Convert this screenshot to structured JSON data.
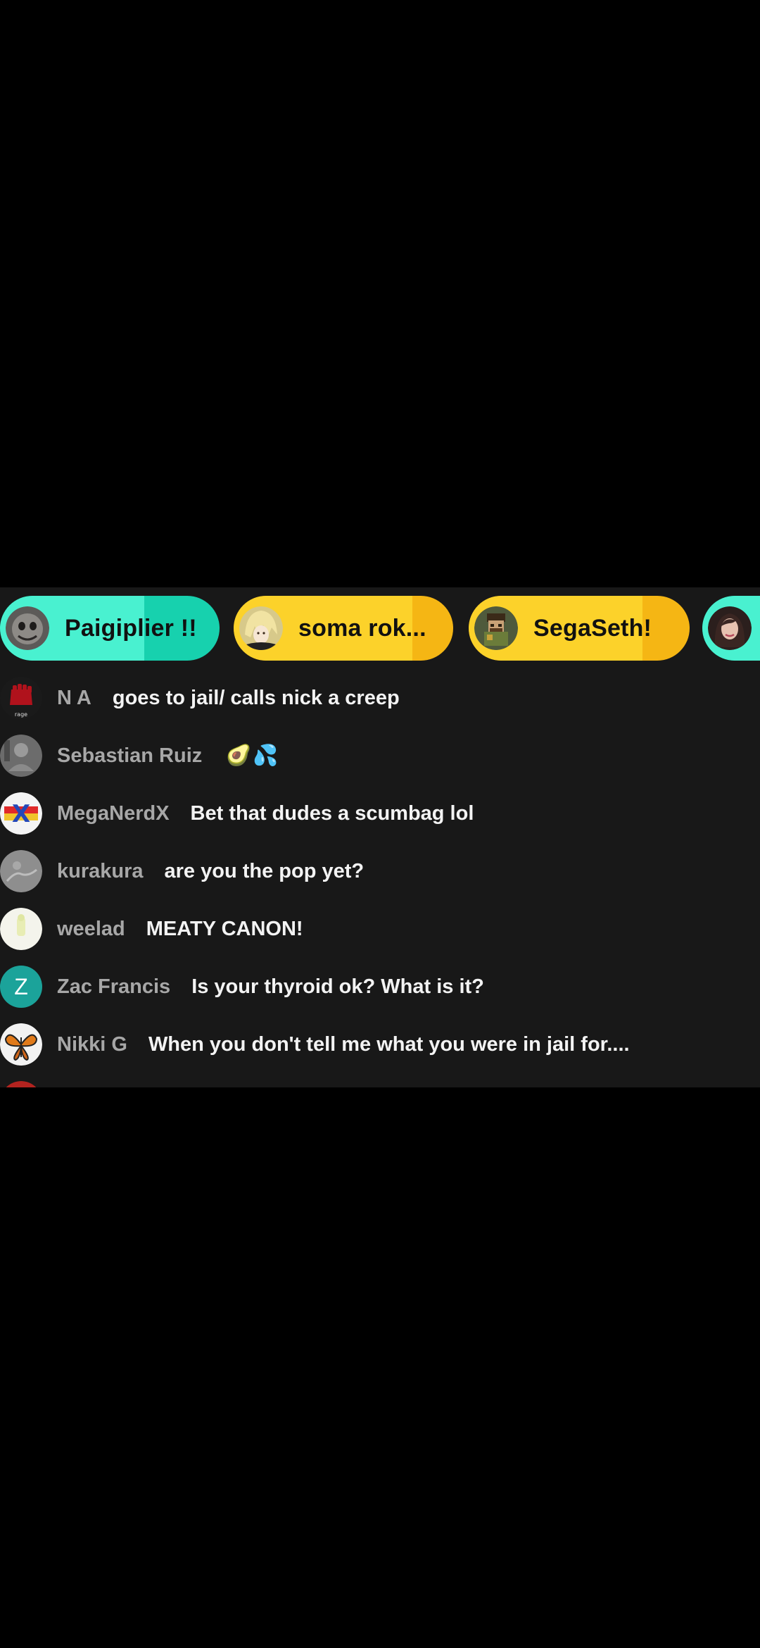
{
  "colors": {
    "background": "#000000",
    "panel": "#181818",
    "pill_teal": "#17d1ae",
    "pill_teal_fill": "#49f1d0",
    "pill_yellow": "#f5b614",
    "pill_yellow_fill": "#fcd22a",
    "username": "#a7a7a7",
    "message": "#f3f3f3",
    "avatar_z": "#1ba39a"
  },
  "top_gifters": [
    {
      "label": "Paigiplier !!",
      "avatar_icon": "creepy-face-avatar"
    },
    {
      "label": "soma rok...",
      "avatar_icon": "blonde-anime-avatar"
    },
    {
      "label": "SegaSeth!",
      "avatar_icon": "pixel-character-avatar"
    },
    {
      "label": "",
      "avatar_icon": "woman-portrait-avatar"
    }
  ],
  "messages": [
    {
      "username": "N A",
      "text": "goes to jail/ calls nick a creep",
      "avatar_icon": "red-fist-avatar",
      "avatar_caption": "rage"
    },
    {
      "username": "Sebastian Ruiz",
      "text": "🥑💦",
      "avatar_icon": "grey-photo-avatar"
    },
    {
      "username": "MegaNerdX",
      "text": "Bet that dudes a scumbag lol",
      "avatar_icon": "x-logo-avatar",
      "avatar_letter": "X"
    },
    {
      "username": "kurakura",
      "text": "are you the pop yet?",
      "avatar_icon": "grey-sketch-avatar"
    },
    {
      "username": "weelad",
      "text": "MEATY CANON!",
      "avatar_icon": "light-figure-avatar"
    },
    {
      "username": "Zac Francis",
      "text": "Is your thyroid ok? What is it?",
      "avatar_icon": "letter-avatar",
      "avatar_letter": "Z"
    },
    {
      "username": "Nikki G",
      "text": "When you don't tell me what you were in jail for....",
      "avatar_icon": "butterfly-avatar"
    }
  ]
}
